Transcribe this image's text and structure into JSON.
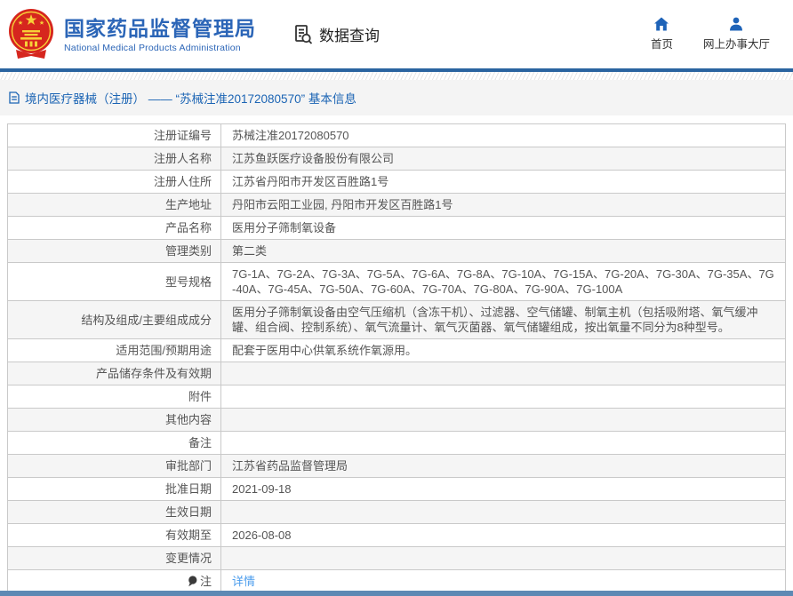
{
  "header": {
    "site_title": "国家药品监督管理局",
    "site_subtitle": "National Medical Products Administration",
    "query": {
      "label": "数据查询"
    },
    "nav": {
      "home": {
        "label": "首页"
      },
      "hall": {
        "label": "网上办事大厅"
      }
    }
  },
  "breadcrumb": {
    "text": "境内医疗器械（注册） —— “苏械注准20172080570” 基本信息"
  },
  "table": {
    "rows": [
      {
        "label": "注册证编号",
        "value": "苏械注准20172080570"
      },
      {
        "label": "注册人名称",
        "value": "江苏鱼跃医疗设备股份有限公司"
      },
      {
        "label": "注册人住所",
        "value": "江苏省丹阳市开发区百胜路1号"
      },
      {
        "label": "生产地址",
        "value": "丹阳市云阳工业园, 丹阳市开发区百胜路1号"
      },
      {
        "label": "产品名称",
        "value": "医用分子筛制氧设备"
      },
      {
        "label": "管理类别",
        "value": "第二类"
      },
      {
        "label": "型号规格",
        "value": "7G-1A、7G-2A、7G-3A、7G-5A、7G-6A、7G-8A、7G-10A、7G-15A、7G-20A、7G-30A、7G-35A、7G-40A、7G-45A、7G-50A、7G-60A、7G-70A、7G-80A、7G-90A、7G-100A"
      },
      {
        "label": "结构及组成/主要组成成分",
        "value": "医用分子筛制氧设备由空气压缩机（含冻干机）、过滤器、空气储罐、制氧主机（包括吸附塔、氧气缓冲罐、组合阀、控制系统）、氧气流量计、氧气灭菌器、氧气储罐组成，按出氧量不同分为8种型号。"
      },
      {
        "label": "适用范围/预期用途",
        "value": "配套于医用中心供氧系统作氧源用。"
      },
      {
        "label": "产品储存条件及有效期",
        "value": ""
      },
      {
        "label": "附件",
        "value": ""
      },
      {
        "label": "其他内容",
        "value": ""
      },
      {
        "label": "备注",
        "value": ""
      },
      {
        "label": "审批部门",
        "value": "江苏省药品监督管理局"
      },
      {
        "label": "批准日期",
        "value": "2021-09-18"
      },
      {
        "label": "生效日期",
        "value": ""
      },
      {
        "label": "有效期至",
        "value": "2026-08-08"
      },
      {
        "label": "变更情况",
        "value": ""
      },
      {
        "label": "注",
        "value": "详情"
      }
    ]
  },
  "colors": {
    "accent_blue": "#2b65b7",
    "nav_icon_blue": "#1e63b8",
    "breadcrumb_blue": "#1b64b4",
    "link_blue": "#4c9ded",
    "top_bar_blue": "#2a64a0",
    "footer_bar_blue": "#5d89b4",
    "emblem_red": "#d6261e",
    "emblem_gold": "#f7d038",
    "border_gray": "#c9c9c9",
    "zebra_gray": "#f5f5f5"
  }
}
